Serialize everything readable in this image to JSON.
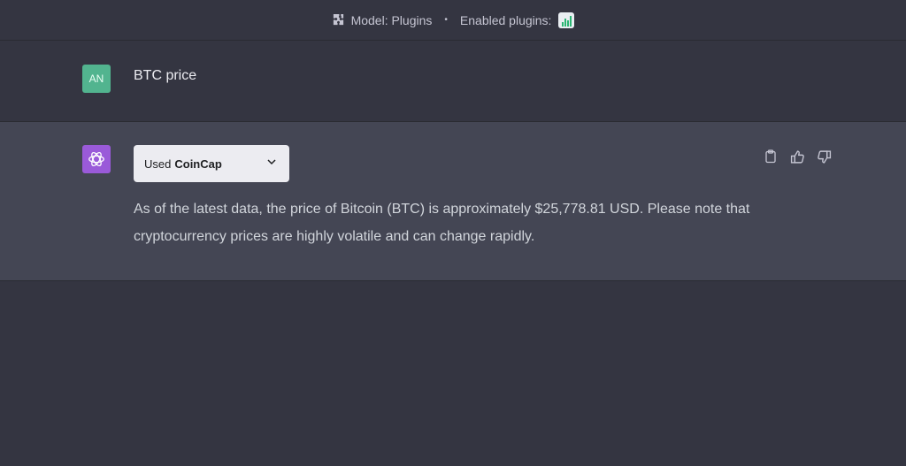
{
  "header": {
    "model_label": "Model: Plugins",
    "separator": "•",
    "enabled_plugins_label": "Enabled plugins:"
  },
  "user_message": {
    "avatar_initials": "AN",
    "text": "BTC price"
  },
  "assistant_message": {
    "plugin_used_prefix": "Used",
    "plugin_name": "CoinCap",
    "answer": "As of the latest data, the price of Bitcoin (BTC) is approximately $25,778.81 USD. Please note that cryptocurrency prices are highly volatile and can change rapidly.",
    "actions": [
      "clipboard-icon",
      "thumbs-up-icon",
      "thumbs-down-icon"
    ]
  },
  "colors": {
    "background": "#343541",
    "assistant_row": "#444654",
    "user_avatar": "#52b48f",
    "assistant_avatar": "#9a5ad9"
  }
}
